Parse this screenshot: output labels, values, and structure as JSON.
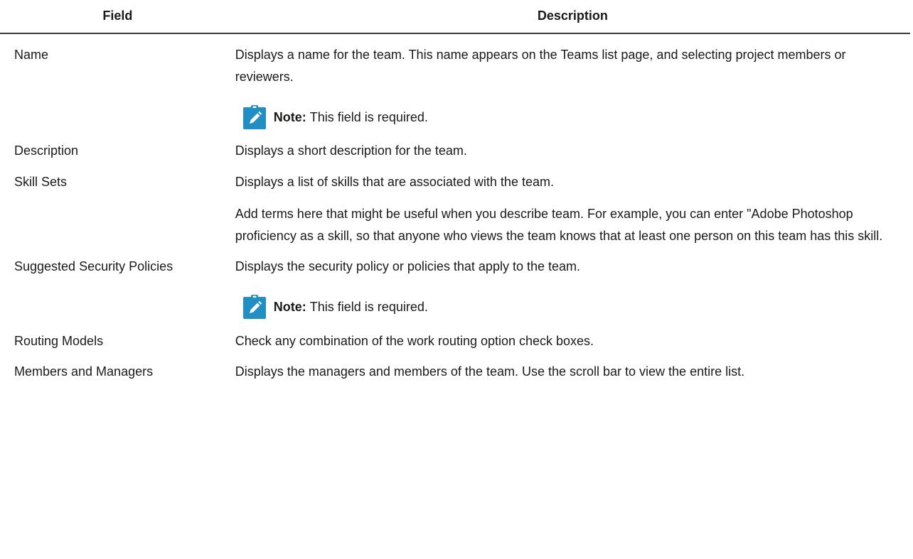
{
  "header": {
    "field_label": "Field",
    "description_label": "Description"
  },
  "rows": [
    {
      "field": "Name",
      "paragraphs": [
        "Displays a name for the team. This name appears on the Teams list page, and selecting project members or reviewers."
      ],
      "note": {
        "label": "Note:",
        "text": "This field is required."
      }
    },
    {
      "field": "Description",
      "paragraphs": [
        "Displays a short description for the team."
      ]
    },
    {
      "field": "Skill Sets",
      "paragraphs": [
        "Displays a list of skills that are associated with the team.",
        "Add terms here that might be useful when you describe team. For example, you can enter \"Adobe Photoshop proficiency as a skill, so that anyone who views the team knows that at least one person on this team has this skill."
      ]
    },
    {
      "field": "Suggested Security Policies",
      "paragraphs": [
        "Displays the security policy or policies that apply to the team."
      ],
      "note": {
        "label": "Note:",
        "text": "This field is required."
      }
    },
    {
      "field": "Routing Models",
      "paragraphs": [
        "Check any combination of the work routing option check boxes."
      ]
    },
    {
      "field": "Members and Managers",
      "paragraphs": [
        "Displays the managers and members of the team. Use the scroll bar to view the entire list."
      ]
    }
  ],
  "colors": {
    "note_icon_bg": "#1f8fc4",
    "text": "#1a1a1a",
    "rule": "#3a3a3a"
  },
  "icons": {
    "note": "pencil-clipboard-icon"
  }
}
